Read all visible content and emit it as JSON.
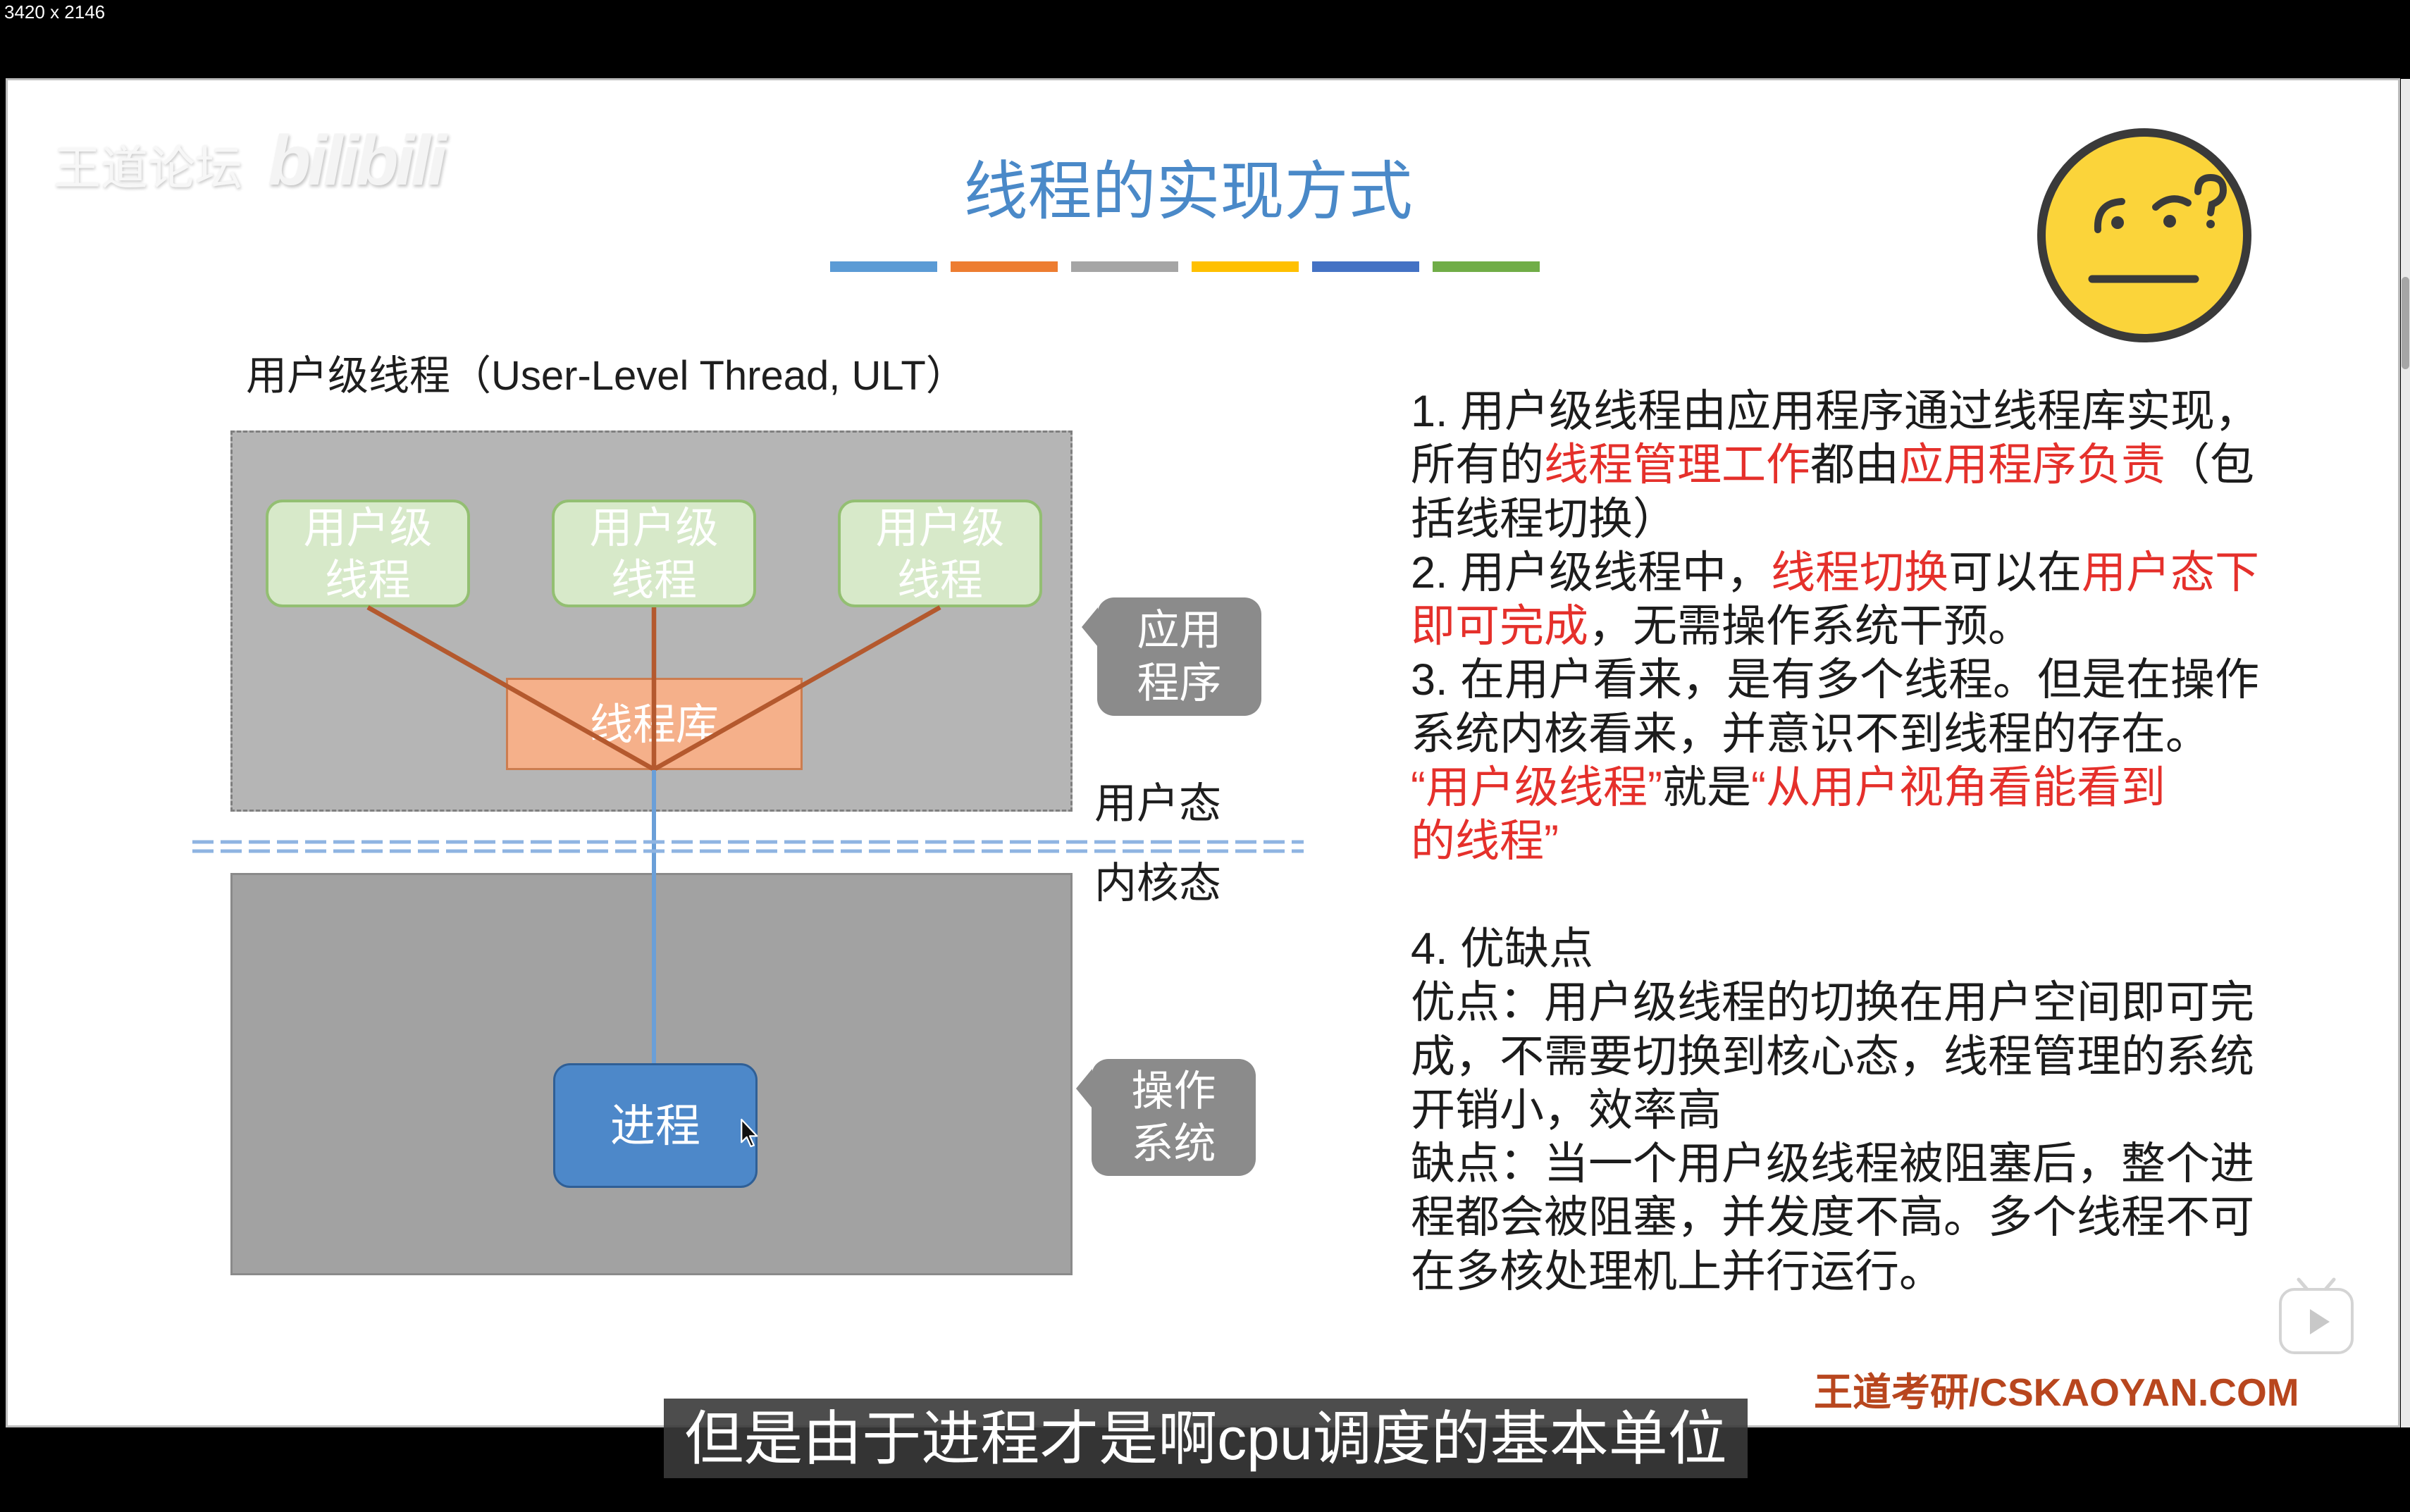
{
  "screen_label": "3420 x 2146",
  "watermark": {
    "brand": "王道论坛",
    "site": "bilibili"
  },
  "slide": {
    "title": "线程的实现方式",
    "colors": {
      "title": "#4a89c8",
      "highlight": "#e5302b",
      "footer": "#b8461e",
      "accent_bars": [
        "#5b9bd5",
        "#ed7d31",
        "#a5a5a5",
        "#ffc000",
        "#4472c4",
        "#70ad47"
      ]
    },
    "emoji_icon": "confused-face-icon",
    "diagram": {
      "heading": "用户级线程（User-Level Thread, ULT）",
      "user_threads": [
        {
          "line1": "用户级",
          "line2": "线程"
        },
        {
          "line1": "用户级",
          "line2": "线程"
        },
        {
          "line1": "用户级",
          "line2": "线程"
        }
      ],
      "thread_library": "线程库",
      "process": "进程",
      "user_mode": "用户态",
      "kernel_mode": "内核态",
      "app_callout": {
        "line1": "应用",
        "line2": "程序"
      },
      "os_callout": {
        "line1": "操作",
        "line2": "系统"
      }
    },
    "explanation": {
      "points": [
        {
          "lines": [
            [
              {
                "text": "1. 用户级线程由应用程序通过线程库实现，"
              }
            ],
            [
              {
                "text": "所有的"
              },
              {
                "text": "线程管理工作",
                "highlight": true
              },
              {
                "text": "都由"
              },
              {
                "text": "应用程序负责",
                "highlight": true
              },
              {
                "text": "（包"
              }
            ],
            [
              {
                "text": "括线程切换）"
              }
            ]
          ]
        },
        {
          "lines": [
            [
              {
                "text": "2. 用户级线程中，"
              },
              {
                "text": "线程切换",
                "highlight": true
              },
              {
                "text": "可以在"
              },
              {
                "text": "用户态下",
                "highlight": true
              }
            ],
            [
              {
                "text": "即可完成",
                "highlight": true
              },
              {
                "text": "，无需操作系统干预。"
              }
            ]
          ]
        },
        {
          "lines": [
            [
              {
                "text": "3. 在用户看来，是有多个线程。但是在操作"
              }
            ],
            [
              {
                "text": "系统内核看来，并意识不到线程的存在。"
              }
            ],
            [
              {
                "text": "“用户级线程”",
                "highlight": true
              },
              {
                "text": "就是"
              },
              {
                "text": "“从用户视角看能看到",
                "highlight": true
              }
            ],
            [
              {
                "text": "的线程”",
                "highlight": true
              }
            ]
          ]
        },
        {
          "lines": [
            [
              {
                "text": "4. 优缺点"
              }
            ],
            [
              {
                "text": "优点：用户级线程的切换在用户空间即可完"
              }
            ],
            [
              {
                "text": "成，不需要切换到核心态，线程管理的系统"
              }
            ],
            [
              {
                "text": "开销小，效率高"
              }
            ],
            [
              {
                "text": "缺点：当一个用户级线程被阻塞后，整个进"
              }
            ],
            [
              {
                "text": "程都会被阻塞，并发度不高。多个线程不可"
              }
            ],
            [
              {
                "text": "在多核处理机上并行运行。"
              }
            ]
          ]
        }
      ]
    },
    "footer": "王道考研/CSKAOYAN.COM"
  },
  "player": {
    "subtitle": "但是由于进程才是啊cpu调度的基本单位",
    "play_icon": "play-icon",
    "cursor_icon": "mouse-pointer-icon"
  }
}
